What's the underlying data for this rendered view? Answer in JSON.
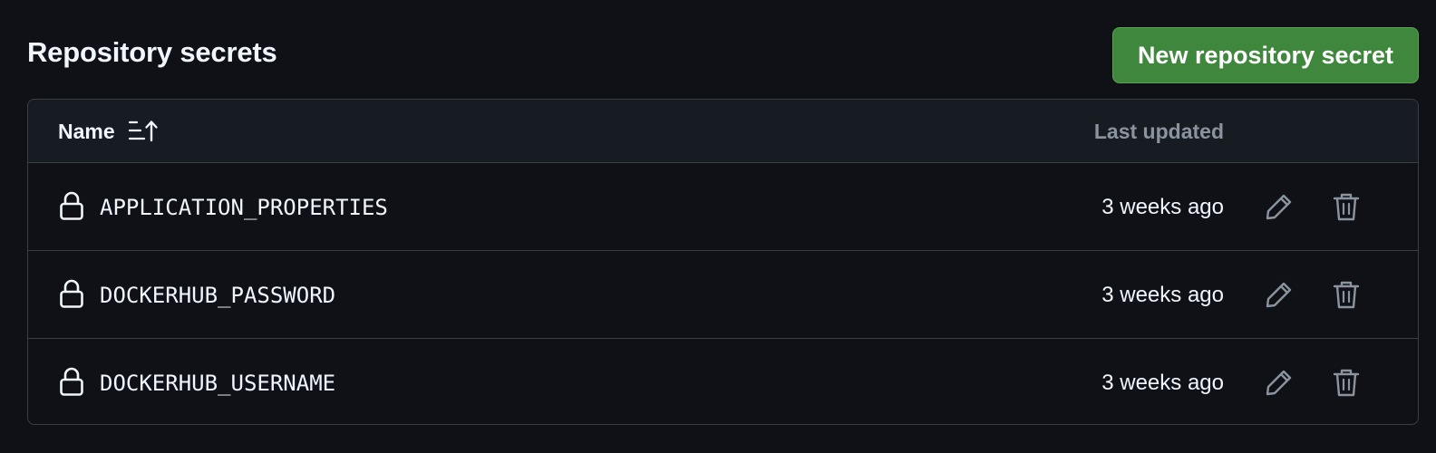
{
  "header": {
    "title": "Repository secrets",
    "new_secret_label": "New repository secret"
  },
  "table": {
    "columns": {
      "name": "Name",
      "last_updated": "Last updated"
    },
    "sort": {
      "column": "name",
      "direction": "ascending",
      "icon": "sort-ascending-icon"
    },
    "rows": [
      {
        "name": "APPLICATION_PROPERTIES",
        "updated": "3 weeks ago"
      },
      {
        "name": "DOCKERHUB_PASSWORD",
        "updated": "3 weeks ago"
      },
      {
        "name": "DOCKERHUB_USERNAME",
        "updated": "3 weeks ago"
      }
    ],
    "row_icon": "lock-icon",
    "row_actions": [
      "pencil-icon",
      "trash-icon"
    ]
  },
  "colors": {
    "background": "#0f1117",
    "header_background": "#171b22",
    "border": "#3a3f47",
    "primary_button": "#3f873d",
    "muted_text": "#8b949e",
    "text": "#f0f6fc"
  }
}
